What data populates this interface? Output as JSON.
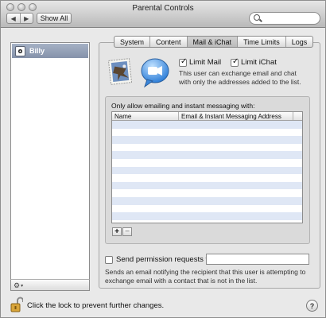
{
  "window": {
    "title": "Parental Controls"
  },
  "toolbar": {
    "back_icon": "chevron-left-icon",
    "forward_icon": "chevron-right-icon",
    "show_all_label": "Show All",
    "search_placeholder": "",
    "search_value": ""
  },
  "sidebar": {
    "users": [
      {
        "name": "Billy",
        "avatar_icon": "soccer-ball-icon",
        "selected": true
      }
    ],
    "footer_action_icon": "gear-icon"
  },
  "tabs": [
    {
      "label": "System",
      "active": false
    },
    {
      "label": "Content",
      "active": false
    },
    {
      "label": "Mail & iChat",
      "active": true
    },
    {
      "label": "Time Limits",
      "active": false
    },
    {
      "label": "Logs",
      "active": false
    }
  ],
  "mail_ichat": {
    "limit_mail_label": "Limit Mail",
    "limit_mail_checked": true,
    "limit_ichat_label": "Limit iChat",
    "limit_ichat_checked": true,
    "description": "This user can exchange email and chat with only the addresses added to the list.",
    "list_label": "Only allow emailing and instant messaging with:",
    "columns": [
      "Name",
      "Email & Instant Messaging Address"
    ],
    "rows": [],
    "add_label": "+",
    "remove_label": "−",
    "send_permission_label": "Send permission requests to:",
    "send_permission_checked": false,
    "send_permission_value": "",
    "send_permission_description": "Sends an email notifying the recipient that this user is attempting to exchange email with a contact that is not in the list."
  },
  "footer": {
    "lock_text": "Click the lock to prevent further changes.",
    "help_label": "?"
  },
  "colors": {
    "selection": "#8e9bb2",
    "stripe": "#dfe7f5",
    "window_bg": "#e9e9e9"
  }
}
